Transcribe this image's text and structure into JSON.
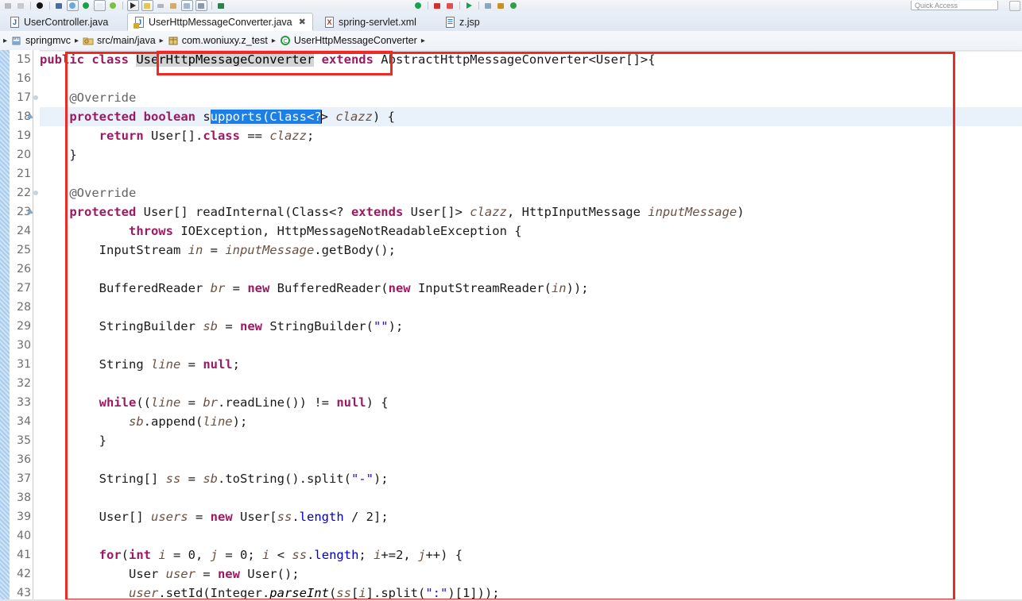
{
  "window": {
    "quick_access_label": "Quick Access"
  },
  "toolbar": {
    "icons": [
      "save-icon",
      "save-all-icon",
      "debug-icon",
      "run-icon",
      "external-tools-icon",
      "search-icon",
      "new-java-class-icon",
      "open-type-icon",
      "open-task-icon",
      "previous-annotation-icon",
      "next-annotation-icon",
      "back-icon",
      "forward-icon",
      "terminate-icon",
      "coverage-icon",
      "profile-icon",
      "pin-editor-icon"
    ]
  },
  "tabs": [
    {
      "label": "UserController.java",
      "icon": "java-file-icon",
      "active": false,
      "closable": false
    },
    {
      "label": "UserHttpMessageConverter.java",
      "icon": "java-file-icon",
      "active": true,
      "closable": true,
      "close_glyph": "✖"
    },
    {
      "label": "spring-servlet.xml",
      "icon": "xml-file-icon",
      "active": false,
      "closable": false
    },
    {
      "label": "z.jsp",
      "icon": "jsp-file-icon",
      "active": false,
      "closable": false
    }
  ],
  "breadcrumb": {
    "items": [
      {
        "label": "springmvc",
        "icon": "project-icon"
      },
      {
        "label": "src/main/java",
        "icon": "source-folder-icon"
      },
      {
        "label": "com.woniuxy.z_test",
        "icon": "package-icon"
      },
      {
        "label": "UserHttpMessageConverter",
        "icon": "class-icon"
      }
    ],
    "separator": "▸"
  },
  "editor": {
    "first_line": 15,
    "current_line": 18,
    "selection_text": "upports(Class<?",
    "occurrence_text": "UserHttpMessageConverter",
    "fold_lines": [
      17,
      22
    ],
    "collapse_lines": [
      18,
      23
    ],
    "lines": [
      {
        "n": 15,
        "segments": [
          {
            "t": "public ",
            "c": "kw"
          },
          {
            "t": "class ",
            "c": "kw"
          },
          {
            "t": "UserHttpMessageConverter",
            "c": "occ"
          },
          {
            "t": " ",
            "c": "pl"
          },
          {
            "t": "extends ",
            "c": "kw"
          },
          {
            "t": "AbstractHttpMessageConverter<User[]>{",
            "c": "pl"
          }
        ]
      },
      {
        "n": 16,
        "segments": []
      },
      {
        "n": 17,
        "segments": [
          {
            "t": "    @Override",
            "c": "ann"
          }
        ]
      },
      {
        "n": 18,
        "segments": [
          {
            "t": "    ",
            "c": "pl"
          },
          {
            "t": "protected ",
            "c": "kw"
          },
          {
            "t": "boolean ",
            "c": "kw"
          },
          {
            "t": "s",
            "c": "pl"
          },
          {
            "t": "upports(Class<?",
            "c": "sel"
          },
          {
            "t": "caret",
            "c": "caret"
          },
          {
            "t": "> ",
            "c": "pl"
          },
          {
            "t": "clazz",
            "c": "loc"
          },
          {
            "t": ") {",
            "c": "pl"
          }
        ]
      },
      {
        "n": 19,
        "segments": [
          {
            "t": "        ",
            "c": "pl"
          },
          {
            "t": "return ",
            "c": "kw"
          },
          {
            "t": "User[].",
            "c": "pl"
          },
          {
            "t": "class",
            "c": "kw"
          },
          {
            "t": " == ",
            "c": "pl"
          },
          {
            "t": "clazz",
            "c": "loc"
          },
          {
            "t": ";",
            "c": "pl"
          }
        ]
      },
      {
        "n": 20,
        "segments": [
          {
            "t": "    }",
            "c": "pl"
          }
        ]
      },
      {
        "n": 21,
        "segments": []
      },
      {
        "n": 22,
        "segments": [
          {
            "t": "    @Override",
            "c": "ann"
          }
        ]
      },
      {
        "n": 23,
        "segments": [
          {
            "t": "    ",
            "c": "pl"
          },
          {
            "t": "protected ",
            "c": "kw"
          },
          {
            "t": "User[] readInternal(Class<? ",
            "c": "pl"
          },
          {
            "t": "extends ",
            "c": "kw"
          },
          {
            "t": "User[]> ",
            "c": "pl"
          },
          {
            "t": "clazz",
            "c": "loc"
          },
          {
            "t": ", HttpInputMessage ",
            "c": "pl"
          },
          {
            "t": "inputMessage",
            "c": "loc"
          },
          {
            "t": ")",
            "c": "pl"
          }
        ]
      },
      {
        "n": 24,
        "segments": [
          {
            "t": "            ",
            "c": "pl"
          },
          {
            "t": "throws ",
            "c": "kw"
          },
          {
            "t": "IOException, HttpMessageNotReadableException {",
            "c": "pl"
          }
        ]
      },
      {
        "n": 25,
        "segments": [
          {
            "t": "        InputStream ",
            "c": "pl"
          },
          {
            "t": "in",
            "c": "loc"
          },
          {
            "t": " = ",
            "c": "pl"
          },
          {
            "t": "inputMessage",
            "c": "loc"
          },
          {
            "t": ".getBody();",
            "c": "pl"
          }
        ]
      },
      {
        "n": 26,
        "segments": []
      },
      {
        "n": 27,
        "segments": [
          {
            "t": "        BufferedReader ",
            "c": "pl"
          },
          {
            "t": "br",
            "c": "loc"
          },
          {
            "t": " = ",
            "c": "pl"
          },
          {
            "t": "new ",
            "c": "kw"
          },
          {
            "t": "BufferedReader(",
            "c": "pl"
          },
          {
            "t": "new ",
            "c": "kw"
          },
          {
            "t": "InputStreamReader(",
            "c": "pl"
          },
          {
            "t": "in",
            "c": "loc"
          },
          {
            "t": "));",
            "c": "pl"
          }
        ]
      },
      {
        "n": 28,
        "segments": []
      },
      {
        "n": 29,
        "segments": [
          {
            "t": "        StringBuilder ",
            "c": "pl"
          },
          {
            "t": "sb",
            "c": "loc"
          },
          {
            "t": " = ",
            "c": "pl"
          },
          {
            "t": "new ",
            "c": "kw"
          },
          {
            "t": "StringBuilder(",
            "c": "pl"
          },
          {
            "t": "\"\"",
            "c": "str"
          },
          {
            "t": ");",
            "c": "pl"
          }
        ]
      },
      {
        "n": 30,
        "segments": []
      },
      {
        "n": 31,
        "segments": [
          {
            "t": "        String ",
            "c": "pl"
          },
          {
            "t": "line",
            "c": "loc"
          },
          {
            "t": " = ",
            "c": "pl"
          },
          {
            "t": "null",
            "c": "kw"
          },
          {
            "t": ";",
            "c": "pl"
          }
        ]
      },
      {
        "n": 32,
        "segments": []
      },
      {
        "n": 33,
        "segments": [
          {
            "t": "        ",
            "c": "pl"
          },
          {
            "t": "while",
            "c": "kw"
          },
          {
            "t": "((",
            "c": "pl"
          },
          {
            "t": "line",
            "c": "loc"
          },
          {
            "t": " = ",
            "c": "pl"
          },
          {
            "t": "br",
            "c": "loc"
          },
          {
            "t": ".readLine()) != ",
            "c": "pl"
          },
          {
            "t": "null",
            "c": "kw"
          },
          {
            "t": ") {",
            "c": "pl"
          }
        ]
      },
      {
        "n": 34,
        "segments": [
          {
            "t": "            ",
            "c": "pl"
          },
          {
            "t": "sb",
            "c": "loc"
          },
          {
            "t": ".append(",
            "c": "pl"
          },
          {
            "t": "line",
            "c": "loc"
          },
          {
            "t": ");",
            "c": "pl"
          }
        ]
      },
      {
        "n": 35,
        "segments": [
          {
            "t": "        }",
            "c": "pl"
          }
        ]
      },
      {
        "n": 36,
        "segments": []
      },
      {
        "n": 37,
        "segments": [
          {
            "t": "        String[] ",
            "c": "pl"
          },
          {
            "t": "ss",
            "c": "loc"
          },
          {
            "t": " = ",
            "c": "pl"
          },
          {
            "t": "sb",
            "c": "loc"
          },
          {
            "t": ".toString().split(",
            "c": "pl"
          },
          {
            "t": "\"-\"",
            "c": "str"
          },
          {
            "t": ");",
            "c": "pl"
          }
        ]
      },
      {
        "n": 38,
        "segments": []
      },
      {
        "n": 39,
        "segments": [
          {
            "t": "        User[] ",
            "c": "pl"
          },
          {
            "t": "users",
            "c": "loc"
          },
          {
            "t": " = ",
            "c": "pl"
          },
          {
            "t": "new ",
            "c": "kw"
          },
          {
            "t": "User[",
            "c": "pl"
          },
          {
            "t": "ss",
            "c": "loc"
          },
          {
            "t": ".",
            "c": "pl"
          },
          {
            "t": "length",
            "c": "fld"
          },
          {
            "t": " / ",
            "c": "pl"
          },
          {
            "t": "2];",
            "c": "pl"
          }
        ]
      },
      {
        "n": 40,
        "segments": []
      },
      {
        "n": 41,
        "segments": [
          {
            "t": "        ",
            "c": "pl"
          },
          {
            "t": "for",
            "c": "kw"
          },
          {
            "t": "(",
            "c": "pl"
          },
          {
            "t": "int ",
            "c": "kw"
          },
          {
            "t": "i",
            "c": "loc"
          },
          {
            "t": " = ",
            "c": "pl"
          },
          {
            "t": "0",
            "c": "pl"
          },
          {
            "t": ", ",
            "c": "pl"
          },
          {
            "t": "j",
            "c": "loc"
          },
          {
            "t": " = ",
            "c": "pl"
          },
          {
            "t": "0",
            "c": "pl"
          },
          {
            "t": "; ",
            "c": "pl"
          },
          {
            "t": "i",
            "c": "loc"
          },
          {
            "t": " < ",
            "c": "pl"
          },
          {
            "t": "ss",
            "c": "loc"
          },
          {
            "t": ".",
            "c": "pl"
          },
          {
            "t": "length",
            "c": "fld"
          },
          {
            "t": "; ",
            "c": "pl"
          },
          {
            "t": "i",
            "c": "loc"
          },
          {
            "t": "+=2, ",
            "c": "pl"
          },
          {
            "t": "j",
            "c": "loc"
          },
          {
            "t": "++) {",
            "c": "pl"
          }
        ]
      },
      {
        "n": 42,
        "segments": [
          {
            "t": "            User ",
            "c": "pl"
          },
          {
            "t": "user",
            "c": "loc"
          },
          {
            "t": " = ",
            "c": "pl"
          },
          {
            "t": "new ",
            "c": "kw"
          },
          {
            "t": "User();",
            "c": "pl"
          }
        ]
      },
      {
        "n": 43,
        "segments": [
          {
            "t": "            ",
            "c": "pl"
          },
          {
            "t": "user",
            "c": "loc"
          },
          {
            "t": ".setId(Integer.",
            "c": "pl"
          },
          {
            "t": "parseInt",
            "c": "stat"
          },
          {
            "t": "(",
            "c": "pl"
          },
          {
            "t": "ss",
            "c": "loc"
          },
          {
            "t": "[",
            "c": "pl"
          },
          {
            "t": "i",
            "c": "loc"
          },
          {
            "t": "].split(",
            "c": "pl"
          },
          {
            "t": "\":\"",
            "c": "str"
          },
          {
            "t": ")[1]));",
            "c": "pl"
          }
        ]
      }
    ]
  },
  "annotations": {
    "main_box_color": "#ee2a24",
    "class_box_color": "#ee2a24"
  },
  "colors": {
    "keyword": "#9b1b62",
    "local_var": "#6b5040",
    "field": "#0000c0",
    "string": "#2a00ff",
    "annotation": "#646464",
    "selection": "#1c7fe8",
    "current_line": "#e9f1fb",
    "occurrence": "#d4d4d4"
  }
}
